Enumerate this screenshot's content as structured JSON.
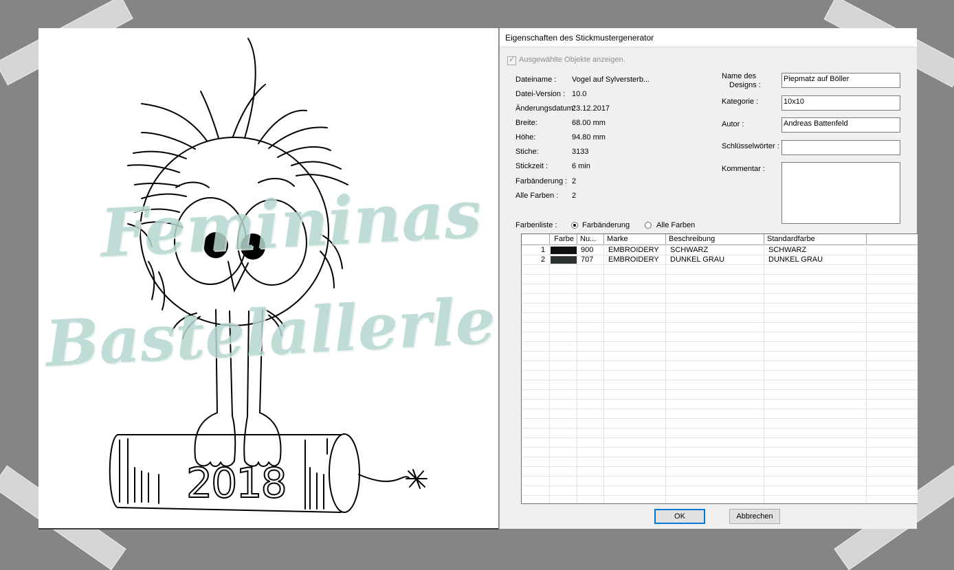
{
  "watermark": {
    "line1": "Femininas",
    "line2": "Bastelallerlei"
  },
  "canvas": {
    "design_text": "2018"
  },
  "dialog": {
    "title": "Eigenschaften des Stickmustergenerator",
    "show_selected_label": "Ausgewählte Objekte anzeigen.",
    "info": [
      {
        "label": "Dateiname :",
        "value": "Vogel auf Sylversterb..."
      },
      {
        "label": "Datei-Version :",
        "value": "10.0"
      },
      {
        "label": "Änderungsdatum:",
        "value": "23.12.2017"
      },
      {
        "label": "Breite:",
        "value": "68.00 mm"
      },
      {
        "label": "Höhe:",
        "value": "94.80 mm"
      },
      {
        "label": "Stiche:",
        "value": "3133"
      },
      {
        "label": "Stickzeit :",
        "value": "6 min"
      },
      {
        "label": "Farbänderung :",
        "value": "2"
      },
      {
        "label": "Alle Farben :",
        "value": "2"
      }
    ],
    "fields": {
      "name_label_1": "Name des",
      "name_label_2": "Designs :",
      "name_value": "Piepmatz auf Böller",
      "category_label": "Kategorie :",
      "category_value": "10x10",
      "author_label": "Autor :",
      "author_value": "Andreas Battenfeld",
      "keywords_label": "Schlüsselwörter :",
      "keywords_value": "",
      "comment_label": "Kommentar :",
      "comment_value": ""
    },
    "color_list": {
      "label": "Farbenliste :",
      "option_changes": "Farbänderung",
      "option_all": "Alle Farben",
      "selected": "Farbänderung"
    },
    "table": {
      "headers": [
        "",
        "Farbe",
        "Nu...",
        "Marke",
        "Beschreibung",
        "Standardfarbe"
      ],
      "rows": [
        {
          "index": "1",
          "color": "#101010",
          "number": "900",
          "brand": "EMBROIDERY",
          "description": "SCHWARZ",
          "standard": "SCHWARZ"
        },
        {
          "index": "2",
          "color": "#2c3232",
          "number": "707",
          "brand": "EMBROIDERY",
          "description": "DUNKEL GRAU",
          "standard": "DUNKEL GRAU"
        }
      ]
    },
    "buttons": {
      "ok": "OK",
      "cancel": "Abbrechen"
    }
  }
}
